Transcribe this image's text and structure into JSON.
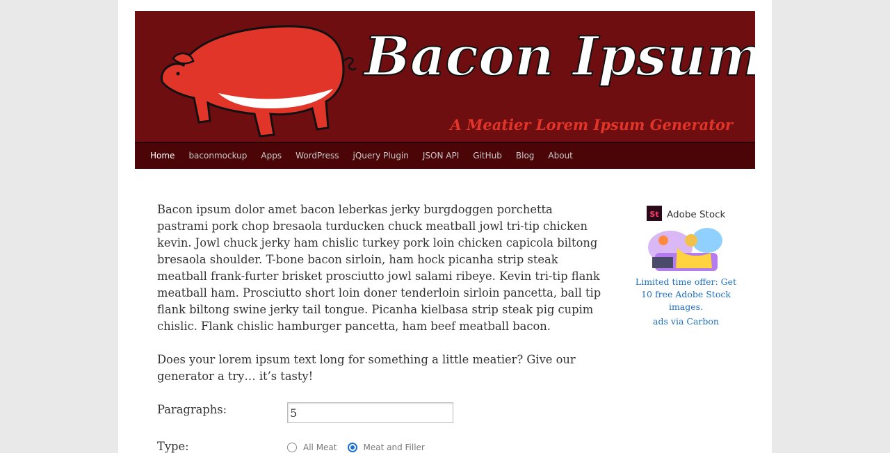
{
  "banner": {
    "title": "Bacon Ipsum",
    "tagline": "A Meatier Lorem Ipsum Generator",
    "logo_icon": "pig-icon"
  },
  "nav": {
    "items": [
      {
        "label": "Home"
      },
      {
        "label": "baconmockup"
      },
      {
        "label": "Apps"
      },
      {
        "label": "WordPress"
      },
      {
        "label": "jQuery Plugin"
      },
      {
        "label": "JSON API"
      },
      {
        "label": "GitHub"
      },
      {
        "label": "Blog"
      },
      {
        "label": "About"
      }
    ],
    "active": "Home"
  },
  "main": {
    "paragraphs": [
      "Bacon ipsum dolor amet bacon leberkas jerky burgdoggen porchetta pastrami pork chop bresaola turducken chuck meatball jowl tri-tip chicken kevin. Jowl chuck jerky ham chislic turkey pork loin chicken capicola biltong bresaola shoulder. T-bone bacon sirloin, ham hock picanha strip steak meatball frank-furter brisket prosciutto jowl salami ribeye. Kevin tri-tip flank meatball ham. Prosciutto short loin doner tenderloin sirloin pancetta, ball tip flank biltong swine jerky tail tongue. Picanha kielbasa strip steak pig cupim chislic. Flank chislic hamburger pancetta, ham beef meatball bacon.",
      "Does your lorem ipsum text long for something a little meatier? Give our generator a try… it’s tasty!"
    ],
    "form": {
      "paragraphs_label": "Paragraphs:",
      "paragraphs_value": "5",
      "type_label": "Type:",
      "type_options": [
        {
          "label": "All Meat",
          "checked": false
        },
        {
          "label": "Meat and Filler",
          "checked": true
        }
      ]
    }
  },
  "ad": {
    "brand_badge": "St",
    "brand_name": "Adobe Stock",
    "text": "Limited time offer: Get 10 free Adobe Stock images.",
    "via": "ads via Carbon"
  },
  "colors": {
    "banner_bg": "#6e0e10",
    "nav_bg": "#4b0507",
    "pig": "#e2352a",
    "link": "#1e6fc0"
  }
}
